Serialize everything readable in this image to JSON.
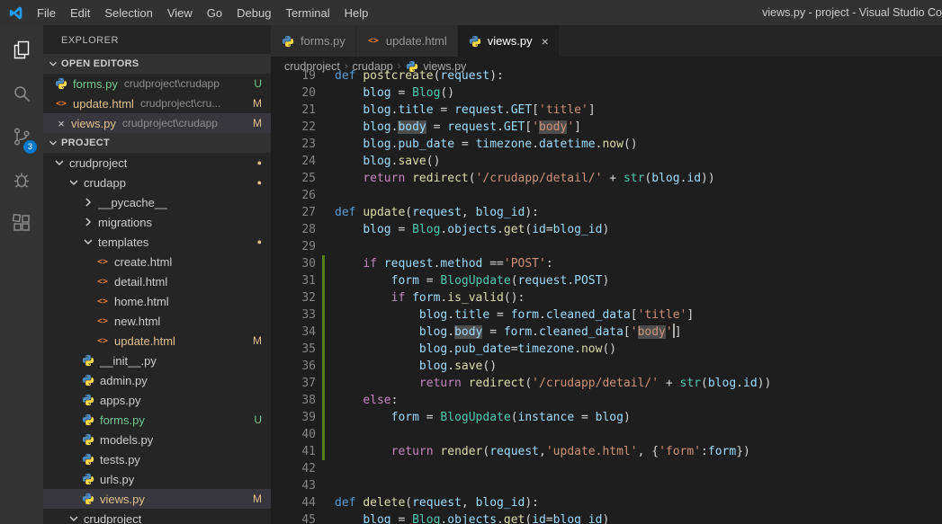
{
  "window": {
    "title": "views.py - project - Visual Studio Co"
  },
  "menu": {
    "items": [
      "File",
      "Edit",
      "Selection",
      "View",
      "Go",
      "Debug",
      "Terminal",
      "Help"
    ]
  },
  "activity_bar": {
    "items": [
      {
        "name": "explorer",
        "active": true
      },
      {
        "name": "search",
        "active": false
      },
      {
        "name": "source-control",
        "active": false,
        "badge": "3"
      },
      {
        "name": "debug",
        "active": false
      },
      {
        "name": "extensions",
        "active": false
      }
    ]
  },
  "sidebar": {
    "title": "EXPLORER",
    "open_editors": {
      "header": "OPEN EDITORS",
      "items": [
        {
          "label": "forms.py",
          "desc": "crudproject\\crudapp",
          "icon": "python",
          "badge": "U",
          "status": "untracked",
          "selected": false,
          "close": false
        },
        {
          "label": "update.html",
          "desc": "crudproject\\cru...",
          "icon": "html",
          "badge": "M",
          "status": "mod",
          "selected": false,
          "close": false
        },
        {
          "label": "views.py",
          "desc": "crudproject\\crudapp",
          "icon": "python",
          "badge": "M",
          "status": "mod",
          "selected": true,
          "close": true
        }
      ]
    },
    "project": {
      "header": "PROJECT",
      "tree": [
        {
          "label": "crudproject",
          "kind": "folder",
          "expanded": true,
          "indent": 0,
          "dot": true
        },
        {
          "label": "crudapp",
          "kind": "folder",
          "expanded": true,
          "indent": 1,
          "dot": true
        },
        {
          "label": "__pycache__",
          "kind": "folder",
          "expanded": false,
          "indent": 2
        },
        {
          "label": "migrations",
          "kind": "folder",
          "expanded": false,
          "indent": 2
        },
        {
          "label": "templates",
          "kind": "folder",
          "expanded": true,
          "indent": 2,
          "dot": true
        },
        {
          "label": "create.html",
          "kind": "html",
          "indent": 3
        },
        {
          "label": "detail.html",
          "kind": "html",
          "indent": 3
        },
        {
          "label": "home.html",
          "kind": "html",
          "indent": 3
        },
        {
          "label": "new.html",
          "kind": "html",
          "indent": 3
        },
        {
          "label": "update.html",
          "kind": "html",
          "indent": 3,
          "badge": "M",
          "status": "mod"
        },
        {
          "label": "__init__.py",
          "kind": "python",
          "indent": 2
        },
        {
          "label": "admin.py",
          "kind": "python",
          "indent": 2
        },
        {
          "label": "apps.py",
          "kind": "python",
          "indent": 2
        },
        {
          "label": "forms.py",
          "kind": "python",
          "indent": 2,
          "badge": "U",
          "status": "untracked"
        },
        {
          "label": "models.py",
          "kind": "python",
          "indent": 2
        },
        {
          "label": "tests.py",
          "kind": "python",
          "indent": 2
        },
        {
          "label": "urls.py",
          "kind": "python",
          "indent": 2
        },
        {
          "label": "views.py",
          "kind": "python",
          "indent": 2,
          "badge": "M",
          "status": "mod",
          "selected": true
        },
        {
          "label": "crudproject",
          "kind": "folder",
          "expanded": true,
          "indent": 1
        }
      ]
    }
  },
  "tabs": [
    {
      "label": "forms.py",
      "icon": "python",
      "active": false
    },
    {
      "label": "update.html",
      "icon": "html",
      "active": false
    },
    {
      "label": "views.py",
      "icon": "python",
      "active": true,
      "close": "×"
    }
  ],
  "breadcrumb": {
    "separator": "›",
    "items": [
      {
        "label": "crudproject"
      },
      {
        "label": "crudapp"
      },
      {
        "label": "views.py",
        "icon": "python"
      }
    ]
  },
  "colors": {
    "accent": "#007acc",
    "git_modified": "#e2c08d",
    "git_untracked": "#73c991",
    "gutter_added": "#587c0c"
  },
  "editor": {
    "lines": [
      {
        "n": 19,
        "g": false,
        "t": [
          [
            "def ",
            "d"
          ],
          [
            "postcreate",
            "f"
          ],
          [
            "(",
            "p"
          ],
          [
            "request",
            "v"
          ],
          [
            "):",
            "p"
          ]
        ]
      },
      {
        "n": 20,
        "g": false,
        "t": [
          [
            "    ",
            "p"
          ],
          [
            "blog",
            "v"
          ],
          [
            " = ",
            "p"
          ],
          [
            "Blog",
            "c"
          ],
          [
            "()",
            "p"
          ]
        ]
      },
      {
        "n": 21,
        "g": false,
        "t": [
          [
            "    ",
            "p"
          ],
          [
            "blog",
            "v"
          ],
          [
            ".",
            "p"
          ],
          [
            "title",
            "v"
          ],
          [
            " = ",
            "p"
          ],
          [
            "request",
            "v"
          ],
          [
            ".",
            "p"
          ],
          [
            "GET",
            "v"
          ],
          [
            "[",
            "p"
          ],
          [
            "'title'",
            "s"
          ],
          [
            "]",
            "p"
          ]
        ]
      },
      {
        "n": 22,
        "g": false,
        "t": [
          [
            "    ",
            "p"
          ],
          [
            "blog",
            "v"
          ],
          [
            ".",
            "p"
          ],
          [
            "body",
            "v",
            1
          ],
          [
            " = ",
            "p"
          ],
          [
            "request",
            "v"
          ],
          [
            ".",
            "p"
          ],
          [
            "GET",
            "v"
          ],
          [
            "[",
            "p"
          ],
          [
            "'",
            "s"
          ],
          [
            "body",
            "s",
            1
          ],
          [
            "'",
            "s"
          ],
          [
            "]",
            "p"
          ]
        ]
      },
      {
        "n": 23,
        "g": false,
        "t": [
          [
            "    ",
            "p"
          ],
          [
            "blog",
            "v"
          ],
          [
            ".",
            "p"
          ],
          [
            "pub_date",
            "v"
          ],
          [
            " = ",
            "p"
          ],
          [
            "timezone",
            "v"
          ],
          [
            ".",
            "p"
          ],
          [
            "datetime",
            "v"
          ],
          [
            ".",
            "p"
          ],
          [
            "now",
            "f"
          ],
          [
            "()",
            "p"
          ]
        ]
      },
      {
        "n": 24,
        "g": false,
        "t": [
          [
            "    ",
            "p"
          ],
          [
            "blog",
            "v"
          ],
          [
            ".",
            "p"
          ],
          [
            "save",
            "f"
          ],
          [
            "()",
            "p"
          ]
        ]
      },
      {
        "n": 25,
        "g": false,
        "t": [
          [
            "    ",
            "p"
          ],
          [
            "return ",
            "k"
          ],
          [
            "redirect",
            "f"
          ],
          [
            "(",
            "p"
          ],
          [
            "'/crudapp/detail/'",
            "s"
          ],
          [
            " + ",
            "p"
          ],
          [
            "str",
            "c"
          ],
          [
            "(",
            "p"
          ],
          [
            "blog",
            "v"
          ],
          [
            ".",
            "p"
          ],
          [
            "id",
            "v"
          ],
          [
            "))",
            "p"
          ]
        ]
      },
      {
        "n": 26,
        "g": false,
        "t": []
      },
      {
        "n": 27,
        "g": false,
        "t": [
          [
            "def ",
            "d"
          ],
          [
            "update",
            "f"
          ],
          [
            "(",
            "p"
          ],
          [
            "request",
            "v"
          ],
          [
            ", ",
            "p"
          ],
          [
            "blog_id",
            "v"
          ],
          [
            "):",
            "p"
          ]
        ]
      },
      {
        "n": 28,
        "g": false,
        "t": [
          [
            "    ",
            "p"
          ],
          [
            "blog",
            "v"
          ],
          [
            " = ",
            "p"
          ],
          [
            "Blog",
            "c"
          ],
          [
            ".",
            "p"
          ],
          [
            "objects",
            "v"
          ],
          [
            ".",
            "p"
          ],
          [
            "get",
            "f"
          ],
          [
            "(",
            "p"
          ],
          [
            "id",
            "v"
          ],
          [
            "=",
            "p"
          ],
          [
            "blog_id",
            "v"
          ],
          [
            ")",
            "p"
          ]
        ]
      },
      {
        "n": 29,
        "g": false,
        "t": []
      },
      {
        "n": 30,
        "g": true,
        "t": [
          [
            "    ",
            "p"
          ],
          [
            "if ",
            "k"
          ],
          [
            "request",
            "v"
          ],
          [
            ".",
            "p"
          ],
          [
            "method",
            "v"
          ],
          [
            " ==",
            "p"
          ],
          [
            "'POST'",
            "s"
          ],
          [
            ":",
            "p"
          ]
        ]
      },
      {
        "n": 31,
        "g": true,
        "t": [
          [
            "        ",
            "p"
          ],
          [
            "form",
            "v"
          ],
          [
            " = ",
            "p"
          ],
          [
            "BlogUpdate",
            "c"
          ],
          [
            "(",
            "p"
          ],
          [
            "request",
            "v"
          ],
          [
            ".",
            "p"
          ],
          [
            "POST",
            "v"
          ],
          [
            ")",
            "p"
          ]
        ]
      },
      {
        "n": 32,
        "g": true,
        "t": [
          [
            "        ",
            "p"
          ],
          [
            "if ",
            "k"
          ],
          [
            "form",
            "v"
          ],
          [
            ".",
            "p"
          ],
          [
            "is_valid",
            "f"
          ],
          [
            "():",
            "p"
          ]
        ]
      },
      {
        "n": 33,
        "g": true,
        "t": [
          [
            "            ",
            "p"
          ],
          [
            "blog",
            "v"
          ],
          [
            ".",
            "p"
          ],
          [
            "title",
            "v"
          ],
          [
            " = ",
            "p"
          ],
          [
            "form",
            "v"
          ],
          [
            ".",
            "p"
          ],
          [
            "cleaned_data",
            "v"
          ],
          [
            "[",
            "p"
          ],
          [
            "'title'",
            "s"
          ],
          [
            "]",
            "p"
          ]
        ]
      },
      {
        "n": 34,
        "g": true,
        "t": [
          [
            "            ",
            "p"
          ],
          [
            "blog",
            "v"
          ],
          [
            ".",
            "p"
          ],
          [
            "body",
            "v",
            1
          ],
          [
            " = ",
            "p"
          ],
          [
            "form",
            "v"
          ],
          [
            ".",
            "p"
          ],
          [
            "cleaned_data",
            "v"
          ],
          [
            "[",
            "p"
          ],
          [
            "'",
            "s"
          ],
          [
            "body",
            "s",
            1
          ],
          [
            "'",
            "s"
          ],
          [
            "",
            "x"
          ],
          [
            "]",
            "p"
          ]
        ]
      },
      {
        "n": 35,
        "g": true,
        "t": [
          [
            "            ",
            "p"
          ],
          [
            "blog",
            "v"
          ],
          [
            ".",
            "p"
          ],
          [
            "pub_date",
            "v"
          ],
          [
            "=",
            "p"
          ],
          [
            "timezone",
            "v"
          ],
          [
            ".",
            "p"
          ],
          [
            "now",
            "f"
          ],
          [
            "()",
            "p"
          ]
        ]
      },
      {
        "n": 36,
        "g": true,
        "t": [
          [
            "            ",
            "p"
          ],
          [
            "blog",
            "v"
          ],
          [
            ".",
            "p"
          ],
          [
            "save",
            "f"
          ],
          [
            "()",
            "p"
          ]
        ]
      },
      {
        "n": 37,
        "g": true,
        "t": [
          [
            "            ",
            "p"
          ],
          [
            "return ",
            "k"
          ],
          [
            "redirect",
            "f"
          ],
          [
            "(",
            "p"
          ],
          [
            "'/crudapp/detail/'",
            "s"
          ],
          [
            " + ",
            "p"
          ],
          [
            "str",
            "c"
          ],
          [
            "(",
            "p"
          ],
          [
            "blog",
            "v"
          ],
          [
            ".",
            "p"
          ],
          [
            "id",
            "v"
          ],
          [
            "))",
            "p"
          ]
        ]
      },
      {
        "n": 38,
        "g": true,
        "t": [
          [
            "    ",
            "p"
          ],
          [
            "else",
            "k"
          ],
          [
            ":",
            "p"
          ]
        ]
      },
      {
        "n": 39,
        "g": true,
        "t": [
          [
            "        ",
            "p"
          ],
          [
            "form",
            "v"
          ],
          [
            " = ",
            "p"
          ],
          [
            "BlogUpdate",
            "c"
          ],
          [
            "(",
            "p"
          ],
          [
            "instance",
            "v"
          ],
          [
            " = ",
            "p"
          ],
          [
            "blog",
            "v"
          ],
          [
            ")",
            "p"
          ]
        ]
      },
      {
        "n": 40,
        "g": true,
        "t": []
      },
      {
        "n": 41,
        "g": true,
        "t": [
          [
            "        ",
            "p"
          ],
          [
            "return ",
            "k"
          ],
          [
            "render",
            "f"
          ],
          [
            "(",
            "p"
          ],
          [
            "request",
            "v"
          ],
          [
            ",",
            "p"
          ],
          [
            "'update.html'",
            "s"
          ],
          [
            ", {",
            "p"
          ],
          [
            "'form'",
            "s"
          ],
          [
            ":",
            "p"
          ],
          [
            "form",
            "v"
          ],
          [
            "})",
            "p"
          ]
        ]
      },
      {
        "n": 42,
        "g": false,
        "t": []
      },
      {
        "n": 43,
        "g": false,
        "t": []
      },
      {
        "n": 44,
        "g": false,
        "t": [
          [
            "def ",
            "d"
          ],
          [
            "delete",
            "f"
          ],
          [
            "(",
            "p"
          ],
          [
            "request",
            "v"
          ],
          [
            ", ",
            "p"
          ],
          [
            "blog_id",
            "v"
          ],
          [
            "):",
            "p"
          ]
        ]
      },
      {
        "n": 45,
        "g": false,
        "t": [
          [
            "    ",
            "p"
          ],
          [
            "blog",
            "v"
          ],
          [
            " = ",
            "p"
          ],
          [
            "Blog",
            "c"
          ],
          [
            ".",
            "p"
          ],
          [
            "objects",
            "v"
          ],
          [
            ".",
            "p"
          ],
          [
            "get",
            "f"
          ],
          [
            "(",
            "p"
          ],
          [
            "id",
            "v"
          ],
          [
            "=",
            "p"
          ],
          [
            "blog_id",
            "v"
          ],
          [
            ")",
            "p"
          ]
        ]
      }
    ]
  }
}
